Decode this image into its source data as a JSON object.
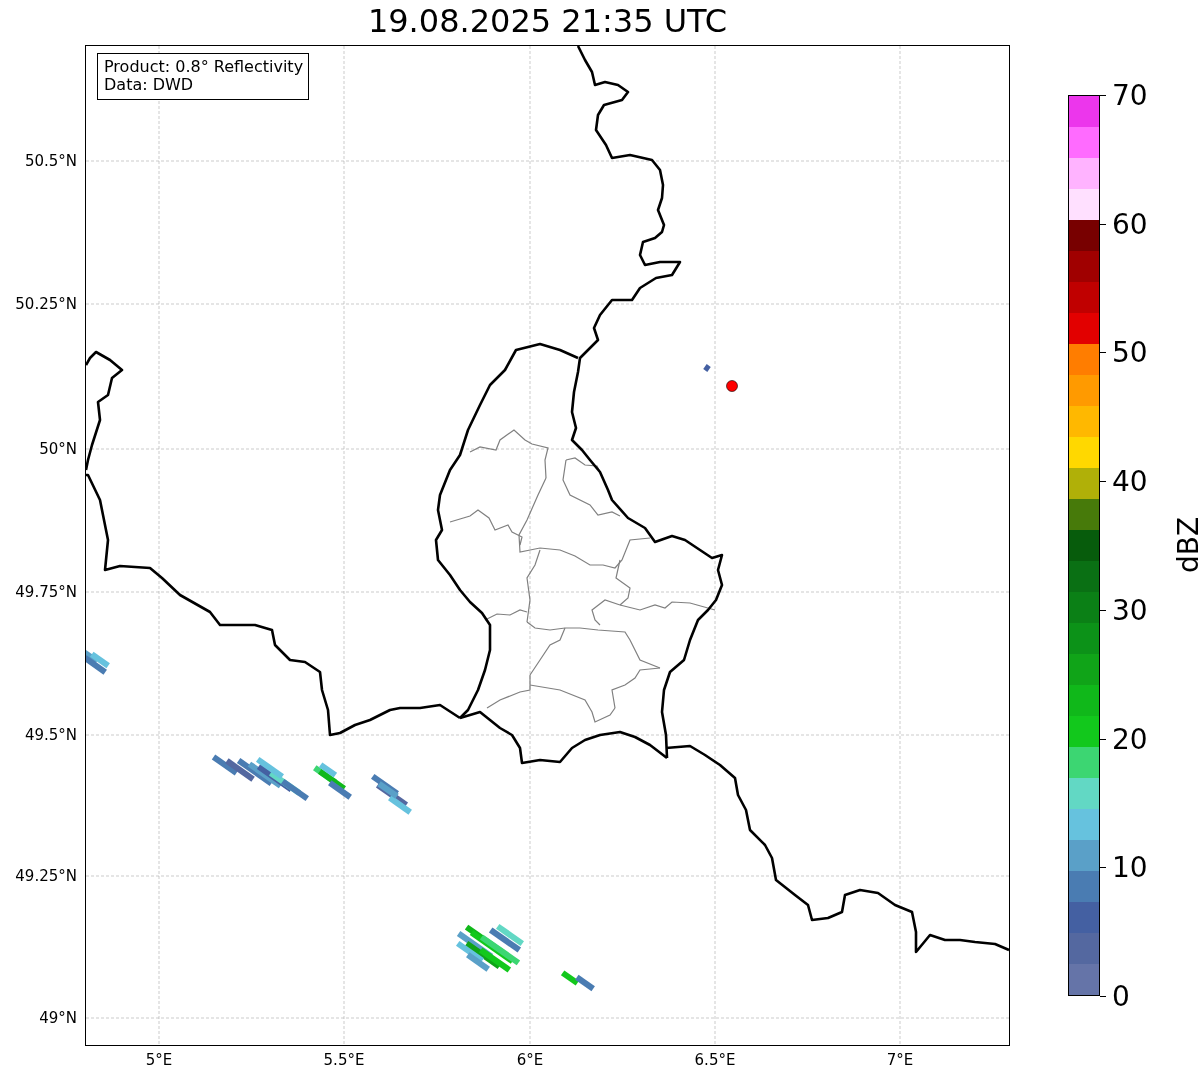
{
  "title": "19.08.2025 21:35 UTC",
  "info_box": {
    "lines": [
      "Product: 0.8° Reflectivity",
      "Data: DWD"
    ]
  },
  "map": {
    "latitude_labels": [
      "50.5°N",
      "50.25°N",
      "50°N",
      "49.75°N",
      "49.5°N",
      "49.25°N",
      "49°N"
    ],
    "longitude_labels": [
      "5°E",
      "5.5°E",
      "6°E",
      "6.5°E",
      "7°E"
    ]
  },
  "colorbar": {
    "label": "dBZ",
    "tick_labels": [
      "70",
      "60",
      "50",
      "40",
      "30",
      "20",
      "10",
      "0"
    ],
    "bands": [
      {
        "color": "#6574a8"
      },
      {
        "color": "#5468a0"
      },
      {
        "color": "#4460a2"
      },
      {
        "color": "#4a7cb2"
      },
      {
        "color": "#5aa0c8"
      },
      {
        "color": "#66c2de"
      },
      {
        "color": "#62d8c4"
      },
      {
        "color": "#3cd672"
      },
      {
        "color": "#12c81c"
      },
      {
        "color": "#10b81a"
      },
      {
        "color": "#10a418"
      },
      {
        "color": "#0c9218"
      },
      {
        "color": "#0b8016"
      },
      {
        "color": "#0a7014"
      },
      {
        "color": "#075c0c"
      },
      {
        "color": "#477a0a"
      },
      {
        "color": "#b0b008"
      },
      {
        "color": "#ffd800"
      },
      {
        "color": "#ffb800"
      },
      {
        "color": "#ff9a00"
      },
      {
        "color": "#ff7d00"
      },
      {
        "color": "#e20000"
      },
      {
        "color": "#c00000"
      },
      {
        "color": "#a00000"
      },
      {
        "color": "#780000"
      },
      {
        "color": "#ffe0ff"
      },
      {
        "color": "#ffb3ff"
      },
      {
        "color": "#ff6bff"
      },
      {
        "color": "#ec36ec"
      }
    ]
  }
}
